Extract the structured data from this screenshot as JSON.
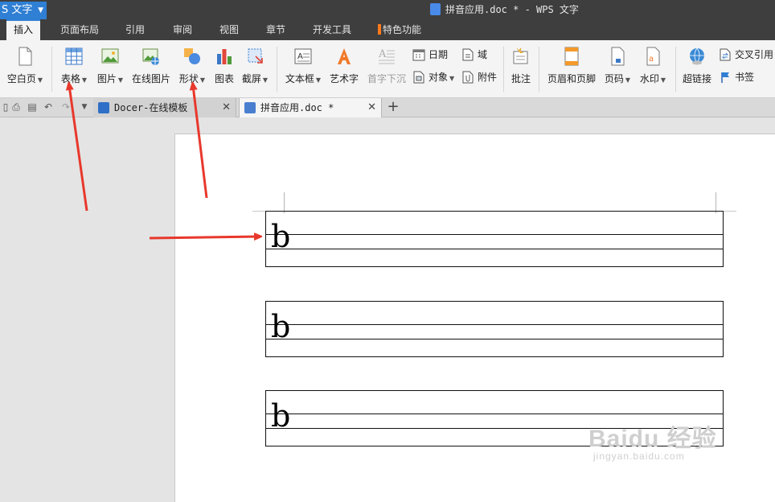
{
  "titlebar": {
    "app_label": "S 文字",
    "document_title": "拼音应用.doc * - WPS 文字"
  },
  "menu_tabs": [
    "插入",
    "页面布局",
    "引用",
    "审阅",
    "视图",
    "章节",
    "开发工具",
    "特色功能"
  ],
  "active_tab": "插入",
  "ribbon": {
    "blank_page": "空白页",
    "table": "表格",
    "picture": "图片",
    "online_picture": "在线图片",
    "shape": "形状",
    "chart": "图表",
    "screenshot": "截屏",
    "text_box": "文本框",
    "word_art": "艺术字",
    "drop_cap": "首字下沉",
    "date": "日期",
    "object": "对象",
    "field": "域",
    "attachment": "附件",
    "comment": "批注",
    "header_footer": "页眉和页脚",
    "page_number": "页码",
    "watermark": "水印",
    "hyperlink": "超链接",
    "cross_reference": "交叉引用",
    "bookmark": "书签"
  },
  "doc_tabs": [
    {
      "label": "Docer-在线模板",
      "active": false
    },
    {
      "label": "拼音应用.doc *",
      "active": true
    }
  ],
  "document": {
    "grids": [
      {
        "letter": "b"
      },
      {
        "letter": "b"
      },
      {
        "letter": "b"
      }
    ]
  },
  "watermark_overlay": {
    "main": "Baidu 经验",
    "sub": "jingyan.baidu.com"
  },
  "colors": {
    "accent_blue": "#2f7fd4",
    "titlebar_dark": "#3e3e3e",
    "annotation_arrow": "#e8382c"
  }
}
